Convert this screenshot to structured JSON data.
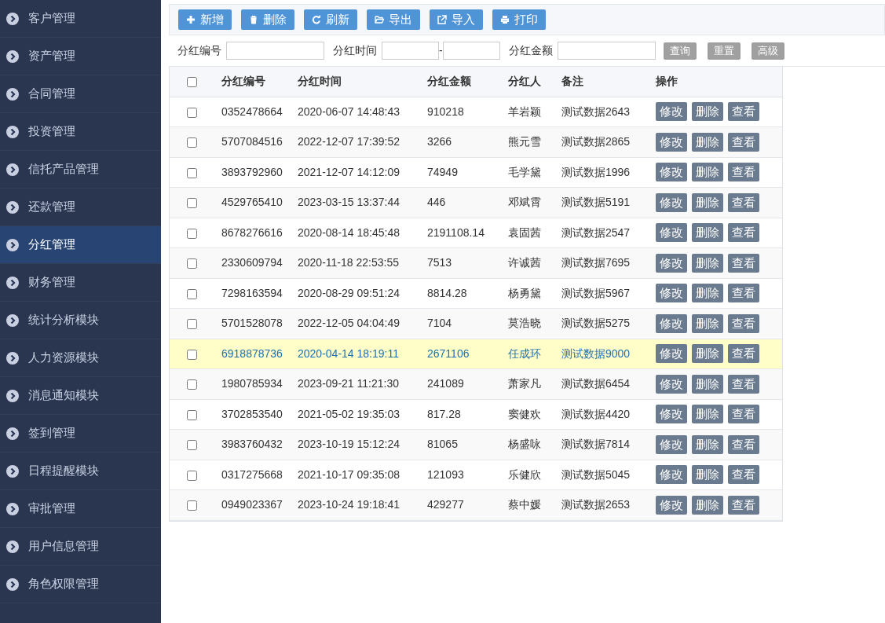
{
  "sidebar": {
    "items": [
      {
        "label": "客户管理",
        "selected": false
      },
      {
        "label": "资产管理",
        "selected": false
      },
      {
        "label": "合同管理",
        "selected": false
      },
      {
        "label": "投资管理",
        "selected": false
      },
      {
        "label": "信托产品管理",
        "selected": false
      },
      {
        "label": "还款管理",
        "selected": false
      },
      {
        "label": "分红管理",
        "selected": true
      },
      {
        "label": "财务管理",
        "selected": false
      },
      {
        "label": "统计分析模块",
        "selected": false
      },
      {
        "label": "人力资源模块",
        "selected": false
      },
      {
        "label": "消息通知模块",
        "selected": false
      },
      {
        "label": "签到管理",
        "selected": false
      },
      {
        "label": "日程提醒模块",
        "selected": false
      },
      {
        "label": "审批管理",
        "selected": false
      },
      {
        "label": "用户信息管理",
        "selected": false
      },
      {
        "label": "角色权限管理",
        "selected": false
      }
    ]
  },
  "toolbar": [
    {
      "kind": "plus",
      "label": "新增"
    },
    {
      "kind": "trash",
      "label": "删除"
    },
    {
      "kind": "refresh",
      "label": "刷新"
    },
    {
      "kind": "folder",
      "label": "导出"
    },
    {
      "kind": "external",
      "label": "导入"
    },
    {
      "kind": "print",
      "label": "打印"
    }
  ],
  "filters": {
    "id_label": "分红编号",
    "time_label": "分红时间",
    "time_separator": "-",
    "amount_label": "分红金额",
    "buttons": [
      "查询",
      "重置",
      "高级"
    ]
  },
  "table": {
    "select_all_checked": false,
    "columns": [
      "分红编号",
      "分红时间",
      "分红金额",
      "分红人",
      "备注",
      "操作"
    ],
    "rows": [
      {
        "id": "0352478664",
        "time": "2020-06-07 14:48:43",
        "amount": "910218",
        "person": "羊岩颖",
        "note": "测试数据2643",
        "actions": [
          "修改",
          "删除",
          "查看"
        ],
        "checked": false,
        "highlighted": false
      },
      {
        "id": "5707084516",
        "time": "2022-12-07 17:39:52",
        "amount": "3266",
        "person": "熊元雪",
        "note": "测试数据2865",
        "actions": [
          "修改",
          "删除",
          "查看"
        ],
        "checked": false,
        "highlighted": false
      },
      {
        "id": "3893792960",
        "time": "2021-12-07 14:12:09",
        "amount": "74949",
        "person": "毛学黛",
        "note": "测试数据1996",
        "actions": [
          "修改",
          "删除",
          "查看"
        ],
        "checked": false,
        "highlighted": false
      },
      {
        "id": "4529765410",
        "time": "2023-03-15 13:37:44",
        "amount": "446",
        "person": "邓斌霄",
        "note": "测试数据5191",
        "actions": [
          "修改",
          "删除",
          "查看"
        ],
        "checked": false,
        "highlighted": false
      },
      {
        "id": "8678276616",
        "time": "2020-08-14 18:45:48",
        "amount": "2191108.14",
        "person": "袁固茜",
        "note": "测试数据2547",
        "actions": [
          "修改",
          "删除",
          "查看"
        ],
        "checked": false,
        "highlighted": false
      },
      {
        "id": "2330609794",
        "time": "2020-11-18 22:53:55",
        "amount": "7513",
        "person": "许诚茜",
        "note": "测试数据7695",
        "actions": [
          "修改",
          "删除",
          "查看"
        ],
        "checked": false,
        "highlighted": false
      },
      {
        "id": "7298163594",
        "time": "2020-08-29 09:51:24",
        "amount": "8814.28",
        "person": "杨勇黛",
        "note": "测试数据5967",
        "actions": [
          "修改",
          "删除",
          "查看"
        ],
        "checked": false,
        "highlighted": false
      },
      {
        "id": "5701528078",
        "time": "2022-12-05 04:04:49",
        "amount": "7104",
        "person": "莫浩晓",
        "note": "测试数据5275",
        "actions": [
          "修改",
          "删除",
          "查看"
        ],
        "checked": false,
        "highlighted": false
      },
      {
        "id": "6918878736",
        "time": "2020-04-14 18:19:11",
        "amount": "2671106",
        "person": "任成环",
        "note": "测试数据9000",
        "actions": [
          "修改",
          "删除",
          "查看"
        ],
        "checked": false,
        "highlighted": true
      },
      {
        "id": "1980785934",
        "time": "2023-09-21 11:21:30",
        "amount": "241089",
        "person": "萧家凡",
        "note": "测试数据6454",
        "actions": [
          "修改",
          "删除",
          "查看"
        ],
        "checked": false,
        "highlighted": false
      },
      {
        "id": "3702853540",
        "time": "2021-05-02 19:35:03",
        "amount": "817.28",
        "person": "窦健欢",
        "note": "测试数据4420",
        "actions": [
          "修改",
          "删除",
          "查看"
        ],
        "checked": false,
        "highlighted": false
      },
      {
        "id": "3983760432",
        "time": "2023-10-19 15:12:24",
        "amount": "81065",
        "person": "杨盛咏",
        "note": "测试数据7814",
        "actions": [
          "修改",
          "删除",
          "查看"
        ],
        "checked": false,
        "highlighted": false
      },
      {
        "id": "0317275668",
        "time": "2021-10-17 09:35:08",
        "amount": "121093",
        "person": "乐健欣",
        "note": "测试数据5045",
        "actions": [
          "修改",
          "删除",
          "查看"
        ],
        "checked": false,
        "highlighted": false
      },
      {
        "id": "0949023367",
        "time": "2023-10-24 19:18:41",
        "amount": "429277",
        "person": "蔡中媛",
        "note": "测试数据2653",
        "actions": [
          "修改",
          "删除",
          "查看"
        ],
        "checked": false,
        "highlighted": false
      }
    ]
  }
}
